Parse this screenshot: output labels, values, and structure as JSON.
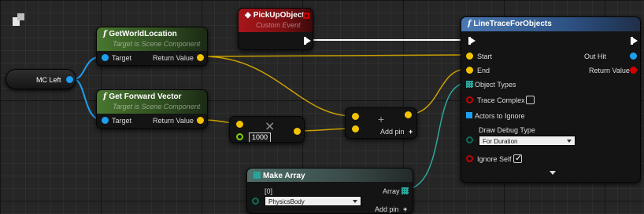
{
  "variable_node": {
    "label": "MC Left"
  },
  "nodes": {
    "get_world_location": {
      "title": "GetWorldLocation",
      "subtitle": "Target is Scene Component",
      "input_label": "Target",
      "output_label": "Return Value"
    },
    "get_forward_vector": {
      "title": "Get Forward Vector",
      "subtitle": "Target is Scene Component",
      "input_label": "Target",
      "output_label": "Return Value"
    },
    "pickup_event": {
      "title": "PickUpObject",
      "subtitle": "Custom Event"
    },
    "multiply": {
      "symbol": "×",
      "value": "1000"
    },
    "add": {
      "symbol": "+",
      "add_pin_label": "Add pin"
    },
    "line_trace": {
      "title": "LineTraceForObjects",
      "inputs": {
        "start": "Start",
        "end": "End",
        "object_types": "Object Types",
        "trace_complex": "Trace Complex",
        "actors_to_ignore": "Actors to Ignore",
        "draw_debug_type": "Draw Debug Type",
        "ignore_self": "Ignore Self"
      },
      "draw_debug_value": "For Duration",
      "trace_complex_checked": false,
      "ignore_self_checked": true,
      "outputs": {
        "out_hit": "Out Hit",
        "return_value": "Return Value"
      }
    },
    "make_array": {
      "title": "Make Array",
      "index_label": "[0]",
      "element_value": "PhysicsBody",
      "output_label": "Array",
      "add_pin_label": "Add pin"
    }
  },
  "colors": {
    "object_pin": "#1e9ff0",
    "vector_pin": "#f2c300",
    "bool_pin": "#d10000",
    "float_pin": "#7fd400",
    "array_pin": "#2aa89c",
    "exec_pin": "#ffffff"
  },
  "icons": [
    "blueprint-logo-icon",
    "function-icon",
    "event-icon",
    "make-array-icon",
    "expand-arrow-icon",
    "plus-icon",
    "multiply-icon"
  ]
}
